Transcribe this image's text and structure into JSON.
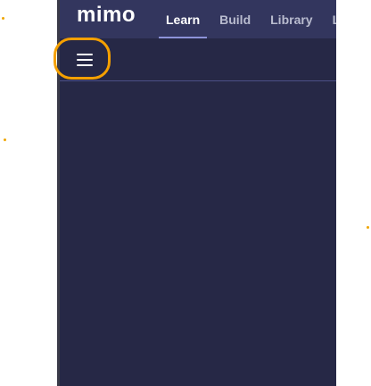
{
  "app": {
    "logo": "mimo"
  },
  "nav": {
    "tabs": [
      {
        "label": "Learn",
        "active": true
      },
      {
        "label": "Build",
        "active": false
      },
      {
        "label": "Library",
        "active": false
      },
      {
        "label": "Li",
        "active": false
      }
    ]
  },
  "toolbar": {
    "menu_icon": "hamburger-icon"
  },
  "colors": {
    "topbar_bg": "#33365e",
    "app_bg": "#262846",
    "highlight": "#f5a000"
  }
}
